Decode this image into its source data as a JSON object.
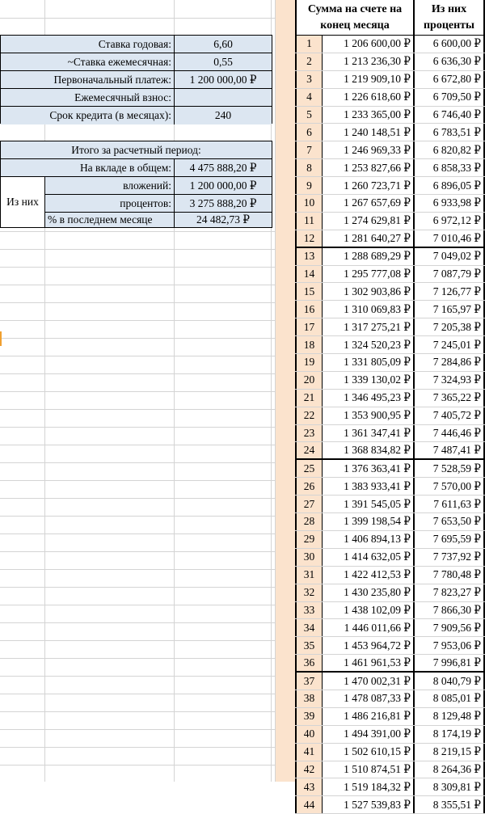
{
  "params": {
    "annual_rate_label": "Ставка годовая:",
    "annual_rate_value": "6,60",
    "monthly_rate_label": "~Ставка ежемесячная:",
    "monthly_rate_value": "0,55",
    "initial_payment_label": "Первоначальный платеж:",
    "initial_payment_value": "1 200 000,00 ₽",
    "monthly_contribution_label": "Ежемесячный взнос:",
    "monthly_contribution_value": "",
    "term_label": "Срок кредита (в месяцах):",
    "term_value": "240"
  },
  "summary": {
    "title": "Итого за расчетный период:",
    "total_label": "На вкладе в общем:",
    "total_value": "4 475 888,20 ₽",
    "of_them_label": "Из них",
    "contributions_label": "вложений:",
    "contributions_value": "1 200 000,00 ₽",
    "interest_label": "процентов:",
    "interest_value": "3 275 888,20 ₽",
    "last_month_label": "% в последнем месяце",
    "last_month_value": "24 482,73 ₽"
  },
  "table": {
    "header_sum": "Сумма на счете на конец месяца",
    "header_pct": "Из них проценты",
    "rows": [
      {
        "n": "1",
        "sum": "1 206 600,00 ₽",
        "pct": "6 600,00 ₽"
      },
      {
        "n": "2",
        "sum": "1 213 236,30 ₽",
        "pct": "6 636,30 ₽"
      },
      {
        "n": "3",
        "sum": "1 219 909,10 ₽",
        "pct": "6 672,80 ₽"
      },
      {
        "n": "4",
        "sum": "1 226 618,60 ₽",
        "pct": "6 709,50 ₽"
      },
      {
        "n": "5",
        "sum": "1 233 365,00 ₽",
        "pct": "6 746,40 ₽"
      },
      {
        "n": "6",
        "sum": "1 240 148,51 ₽",
        "pct": "6 783,51 ₽"
      },
      {
        "n": "7",
        "sum": "1 246 969,33 ₽",
        "pct": "6 820,82 ₽"
      },
      {
        "n": "8",
        "sum": "1 253 827,66 ₽",
        "pct": "6 858,33 ₽"
      },
      {
        "n": "9",
        "sum": "1 260 723,71 ₽",
        "pct": "6 896,05 ₽"
      },
      {
        "n": "10",
        "sum": "1 267 657,69 ₽",
        "pct": "6 933,98 ₽"
      },
      {
        "n": "11",
        "sum": "1 274 629,81 ₽",
        "pct": "6 972,12 ₽"
      },
      {
        "n": "12",
        "sum": "1 281 640,27 ₽",
        "pct": "7 010,46 ₽"
      },
      {
        "n": "13",
        "sum": "1 288 689,29 ₽",
        "pct": "7 049,02 ₽"
      },
      {
        "n": "14",
        "sum": "1 295 777,08 ₽",
        "pct": "7 087,79 ₽"
      },
      {
        "n": "15",
        "sum": "1 302 903,86 ₽",
        "pct": "7 126,77 ₽"
      },
      {
        "n": "16",
        "sum": "1 310 069,83 ₽",
        "pct": "7 165,97 ₽"
      },
      {
        "n": "17",
        "sum": "1 317 275,21 ₽",
        "pct": "7 205,38 ₽"
      },
      {
        "n": "18",
        "sum": "1 324 520,23 ₽",
        "pct": "7 245,01 ₽"
      },
      {
        "n": "19",
        "sum": "1 331 805,09 ₽",
        "pct": "7 284,86 ₽"
      },
      {
        "n": "20",
        "sum": "1 339 130,02 ₽",
        "pct": "7 324,93 ₽"
      },
      {
        "n": "21",
        "sum": "1 346 495,23 ₽",
        "pct": "7 365,22 ₽"
      },
      {
        "n": "22",
        "sum": "1 353 900,95 ₽",
        "pct": "7 405,72 ₽"
      },
      {
        "n": "23",
        "sum": "1 361 347,41 ₽",
        "pct": "7 446,46 ₽"
      },
      {
        "n": "24",
        "sum": "1 368 834,82 ₽",
        "pct": "7 487,41 ₽"
      },
      {
        "n": "25",
        "sum": "1 376 363,41 ₽",
        "pct": "7 528,59 ₽"
      },
      {
        "n": "26",
        "sum": "1 383 933,41 ₽",
        "pct": "7 570,00 ₽"
      },
      {
        "n": "27",
        "sum": "1 391 545,05 ₽",
        "pct": "7 611,63 ₽"
      },
      {
        "n": "28",
        "sum": "1 399 198,54 ₽",
        "pct": "7 653,50 ₽"
      },
      {
        "n": "29",
        "sum": "1 406 894,13 ₽",
        "pct": "7 695,59 ₽"
      },
      {
        "n": "30",
        "sum": "1 414 632,05 ₽",
        "pct": "7 737,92 ₽"
      },
      {
        "n": "31",
        "sum": "1 422 412,53 ₽",
        "pct": "7 780,48 ₽"
      },
      {
        "n": "32",
        "sum": "1 430 235,80 ₽",
        "pct": "7 823,27 ₽"
      },
      {
        "n": "33",
        "sum": "1 438 102,09 ₽",
        "pct": "7 866,30 ₽"
      },
      {
        "n": "34",
        "sum": "1 446 011,66 ₽",
        "pct": "7 909,56 ₽"
      },
      {
        "n": "35",
        "sum": "1 453 964,72 ₽",
        "pct": "7 953,06 ₽"
      },
      {
        "n": "36",
        "sum": "1 461 961,53 ₽",
        "pct": "7 996,81 ₽"
      },
      {
        "n": "37",
        "sum": "1 470 002,31 ₽",
        "pct": "8 040,79 ₽"
      },
      {
        "n": "38",
        "sum": "1 478 087,33 ₽",
        "pct": "8 085,01 ₽"
      },
      {
        "n": "39",
        "sum": "1 486 216,81 ₽",
        "pct": "8 129,48 ₽"
      },
      {
        "n": "40",
        "sum": "1 494 391,00 ₽",
        "pct": "8 174,19 ₽"
      },
      {
        "n": "41",
        "sum": "1 502 610,15 ₽",
        "pct": "8 219,15 ₽"
      },
      {
        "n": "42",
        "sum": "1 510 874,51 ₽",
        "pct": "8 264,36 ₽"
      },
      {
        "n": "43",
        "sum": "1 519 184,32 ₽",
        "pct": "8 309,81 ₽"
      },
      {
        "n": "44",
        "sum": "1 527 539,83 ₽",
        "pct": "8 355,51 ₽"
      }
    ]
  }
}
